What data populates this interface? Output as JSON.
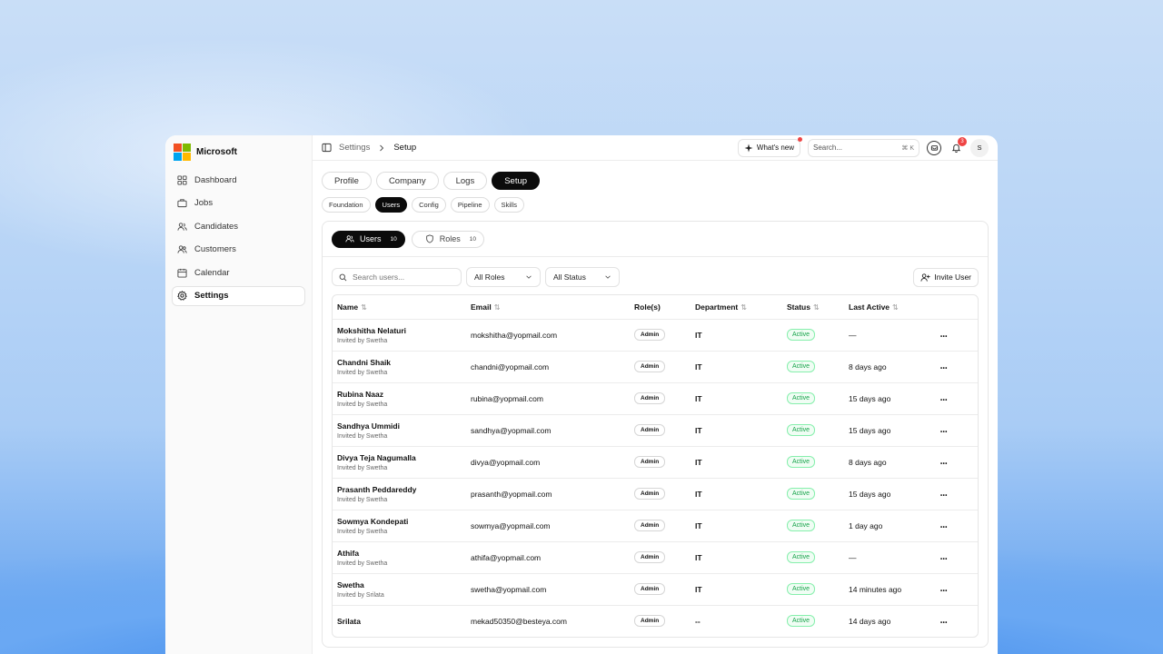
{
  "app": {
    "brand": "Microsoft"
  },
  "sidebar": {
    "items": [
      {
        "label": "Dashboard",
        "icon": "dashboard-icon"
      },
      {
        "label": "Jobs",
        "icon": "briefcase-icon"
      },
      {
        "label": "Candidates",
        "icon": "users-icon"
      },
      {
        "label": "Customers",
        "icon": "customers-icon"
      },
      {
        "label": "Calendar",
        "icon": "calendar-icon"
      },
      {
        "label": "Settings",
        "icon": "gear-icon",
        "active": true
      }
    ]
  },
  "topbar": {
    "breadcrumb": [
      "Settings",
      "Setup"
    ],
    "whats_new": "What's new",
    "search_placeholder": "Search...",
    "search_shortcut": "⌘ K",
    "notifications_count": "3",
    "avatar_initial": "S"
  },
  "tabs": [
    "Profile",
    "Company",
    "Logs",
    "Setup"
  ],
  "active_tab": "Setup",
  "subtabs": [
    "Foundation",
    "Users",
    "Config",
    "Pipeline",
    "Skills"
  ],
  "active_subtab": "Users",
  "panel": {
    "pills": [
      {
        "label": "Users",
        "count": "10",
        "active": true
      },
      {
        "label": "Roles",
        "count": "10",
        "active": false
      }
    ],
    "search_placeholder": "Search users...",
    "role_filter": "All Roles",
    "status_filter": "All Status",
    "invite_label": "Invite User"
  },
  "table": {
    "columns": [
      "Name",
      "Email",
      "Role(s)",
      "Department",
      "Status",
      "Last Active"
    ],
    "sortable": [
      true,
      true,
      false,
      true,
      true,
      true
    ],
    "rows": [
      {
        "name": "Mokshitha Nelaturi",
        "sub": "Invited by Swetha",
        "email": "mokshitha@yopmail.com",
        "role": "Admin",
        "dept": "IT",
        "status": "Active",
        "last": "—"
      },
      {
        "name": "Chandni Shaik",
        "sub": "Invited by Swetha",
        "email": "chandni@yopmail.com",
        "role": "Admin",
        "dept": "IT",
        "status": "Active",
        "last": "8 days ago"
      },
      {
        "name": "Rubina Naaz",
        "sub": "Invited by Swetha",
        "email": "rubina@yopmail.com",
        "role": "Admin",
        "dept": "IT",
        "status": "Active",
        "last": "15 days ago"
      },
      {
        "name": "Sandhya Ummidi",
        "sub": "Invited by Swetha",
        "email": "sandhya@yopmail.com",
        "role": "Admin",
        "dept": "IT",
        "status": "Active",
        "last": "15 days ago"
      },
      {
        "name": "Divya Teja  Nagumalla",
        "sub": "Invited by Swetha",
        "email": "divya@yopmail.com",
        "role": "Admin",
        "dept": "IT",
        "status": "Active",
        "last": "8 days ago"
      },
      {
        "name": "Prasanth Peddareddy",
        "sub": "Invited by Swetha",
        "email": "prasanth@yopmail.com",
        "role": "Admin",
        "dept": "IT",
        "status": "Active",
        "last": "15 days ago"
      },
      {
        "name": "Sowmya Kondepati",
        "sub": "Invited by Swetha",
        "email": "sowmya@yopmail.com",
        "role": "Admin",
        "dept": "IT",
        "status": "Active",
        "last": "1 day ago"
      },
      {
        "name": "Athifa",
        "sub": "Invited by Swetha",
        "email": "athifa@yopmail.com",
        "role": "Admin",
        "dept": "IT",
        "status": "Active",
        "last": "—"
      },
      {
        "name": "Swetha",
        "sub": "Invited by Srilata",
        "email": "swetha@yopmail.com",
        "role": "Admin",
        "dept": "IT",
        "status": "Active",
        "last": "14 minutes ago"
      },
      {
        "name": "Srilata",
        "sub": "",
        "email": "mekad50350@besteya.com",
        "role": "Admin",
        "dept": "--",
        "status": "Active",
        "last": "14 days ago"
      }
    ]
  },
  "colors": {
    "accent": "#0b0b0b",
    "active_green": "#16a34a",
    "notify_red": "#ef4444"
  }
}
